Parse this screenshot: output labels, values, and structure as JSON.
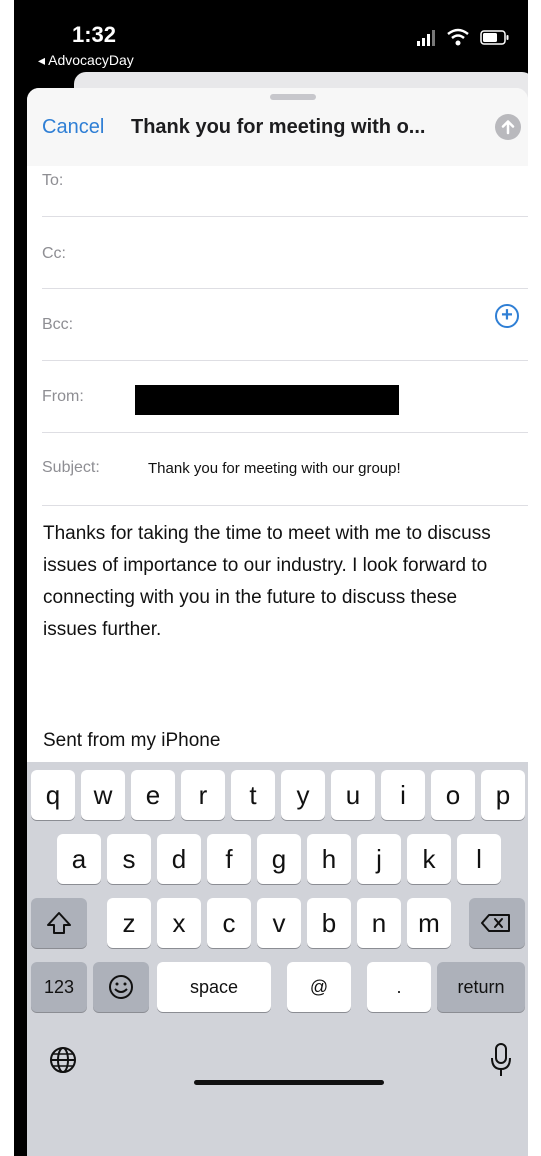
{
  "status_bar": {
    "time": "1:32",
    "back_app": "◂ AdvocacyDay"
  },
  "compose": {
    "cancel": "Cancel",
    "title": "Thank you for meeting with o...",
    "send_icon": "arrow-up-icon",
    "fields": {
      "to_label": "To:",
      "cc_label": "Cc:",
      "bcc_label": "Bcc:",
      "add_icon": "+",
      "from_label": "From:",
      "subject_label": "Subject:",
      "subject_value": "Thank you for meeting with our group!"
    },
    "body": "Thanks for taking the time to meet with me to discuss issues of importance to our industry. I look forward to connecting with you in the future to discuss these issues further.",
    "signature": "Sent from my iPhone"
  },
  "keyboard": {
    "row1": [
      "q",
      "w",
      "e",
      "r",
      "t",
      "y",
      "u",
      "i",
      "o",
      "p"
    ],
    "row2": [
      "a",
      "s",
      "d",
      "f",
      "g",
      "h",
      "j",
      "k",
      "l"
    ],
    "row3": [
      "z",
      "x",
      "c",
      "v",
      "b",
      "n",
      "m"
    ],
    "numbers": "123",
    "space": "space",
    "at": "@",
    "period": ".",
    "return": "return",
    "icons": [
      "shift-icon",
      "delete-icon",
      "emoji-icon",
      "globe-icon",
      "microphone-icon"
    ]
  }
}
